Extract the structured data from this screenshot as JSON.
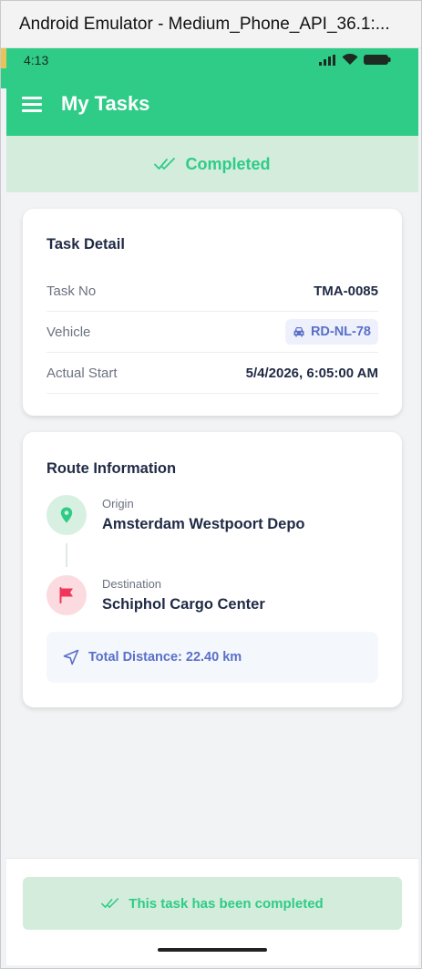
{
  "window": {
    "title": "Android Emulator - Medium_Phone_API_36.1:..."
  },
  "status_bar": {
    "time": "4:13"
  },
  "app_bar": {
    "title": "My Tasks"
  },
  "status_banner": {
    "label": "Completed"
  },
  "task_detail": {
    "title": "Task Detail",
    "rows": [
      {
        "label": "Task No",
        "value": "TMA-0085"
      },
      {
        "label": "Vehicle",
        "value": "RD-NL-78"
      },
      {
        "label": "Actual Start",
        "value": "5/4/2026, 6:05:00 AM"
      }
    ]
  },
  "route": {
    "title": "Route Information",
    "origin": {
      "label": "Origin",
      "name": "Amsterdam Westpoort Depo"
    },
    "destination": {
      "label": "Destination",
      "name": "Schiphol Cargo Center"
    },
    "distance": "Total Distance: 22.40 km"
  },
  "footer": {
    "completed_label": "This task has been completed"
  },
  "colors": {
    "primary": "#2ecc87",
    "banner_bg": "#d4ecdc",
    "accent_blue": "#5a6fc9",
    "origin_bg": "#d7f0e1",
    "destination_bg": "#fbdbe0",
    "destination_icon": "#f0365a"
  },
  "icons": {
    "menu": "hamburger-menu-icon",
    "check": "double-check-icon",
    "vehicle": "car-icon",
    "origin": "map-pin-icon",
    "destination": "flag-icon",
    "distance": "navigation-arrow-icon"
  }
}
